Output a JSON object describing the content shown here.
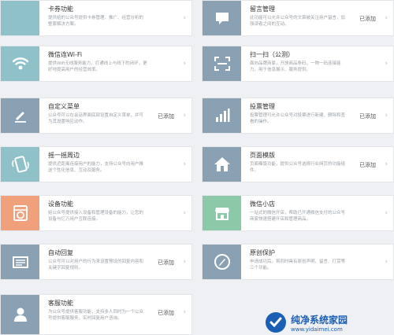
{
  "plugins": [
    {
      "id": "card-coupon",
      "title": "卡券功能",
      "desc": "提供给的公众号提供卡券管理、推广、经营分析的整套解决方案。",
      "status": "",
      "color": "#8fc1c9",
      "icon": "card-icon"
    },
    {
      "id": "message",
      "title": "留言管理",
      "desc": "此功能可以允许公众号的文章被关注用户留言，加强读者之间的互动。",
      "status": "已添加",
      "color": "#8aa1b3",
      "icon": "chat-icon"
    },
    {
      "id": "wifi",
      "title": "微信连Wi-Fi",
      "desc": "提供Wifi无线服务能力，打通线上与线下的闭环，更好地提高用户的经营效率。",
      "status": "",
      "color": "#8fc1c9",
      "icon": "wifi-icon"
    },
    {
      "id": "scan",
      "title": "扫一扫（公测）",
      "desc": "面向品牌商家，开放商品条码，一物一码连接能力，用于信息展示、服务提供。",
      "status": "",
      "color": "#8aa1b3",
      "icon": "scan-icon"
    },
    {
      "id": "custom-menu",
      "title": "自定义菜单",
      "desc": "公众号可以在会话界面底部设置自定义菜单，并可为其设置响应动作。",
      "status": "已添加",
      "color": "#8aa1b3",
      "icon": "pen-icon"
    },
    {
      "id": "vote",
      "title": "投票管理",
      "desc": "投票管理可允许公众号对投票进行新建、删除和查看的操作。",
      "status": "已添加",
      "color": "#8aa1b3",
      "icon": "bar-chart-icon"
    },
    {
      "id": "shake",
      "title": "摇一摇周边",
      "desc": "提供近距离连接用户的能力，支持公众号向用户推送个性化信息、互动及服务。",
      "status": "",
      "color": "#8fc1c9",
      "icon": "shake-phone-icon"
    },
    {
      "id": "page-template",
      "title": "页面模版",
      "desc": "页面模版功能，提供公众号选择行业网页的功能组件。",
      "status": "已添加",
      "color": "#8aa1b3",
      "icon": "house-icon"
    },
    {
      "id": "device",
      "title": "设备功能",
      "desc": "给公众号提供接入设备和管理设备的能力，让您的设备与亿万用户互联连接。",
      "status": "",
      "color": "#f0a17c",
      "icon": "washer-icon"
    },
    {
      "id": "wx-store",
      "title": "微信小店",
      "desc": "一站式的微信开店，帮助已开通微信支付的公众号商家快速搭建开店和管理商品。",
      "status": "",
      "color": "#8cc9a8",
      "icon": "store-icon"
    },
    {
      "id": "auto-reply",
      "title": "自动回复",
      "desc": "公众号可以对用户的行为来设置预设的回复内容和关键字回复规则。",
      "status": "已添加",
      "color": "#8aa1b3",
      "icon": "keyboard-icon"
    },
    {
      "id": "original-protect",
      "title": "原创保护",
      "desc": "申请成功后，将同时具有原创声明、留言、打赏等三个功能。",
      "status": "",
      "color": "#8aa1b3",
      "icon": "compass-icon"
    },
    {
      "id": "customer-service",
      "title": "客服功能",
      "desc": "为公众号提供客服功能，支持多人同时为一个公众号提供客服服务，实时回复用户咨询。",
      "status": "已添加",
      "color": "#8aa1b3",
      "icon": "person-icon"
    }
  ],
  "chevron": "›",
  "watermark": {
    "name": "纯净系统家园",
    "url": "www.yidaimei.com"
  }
}
